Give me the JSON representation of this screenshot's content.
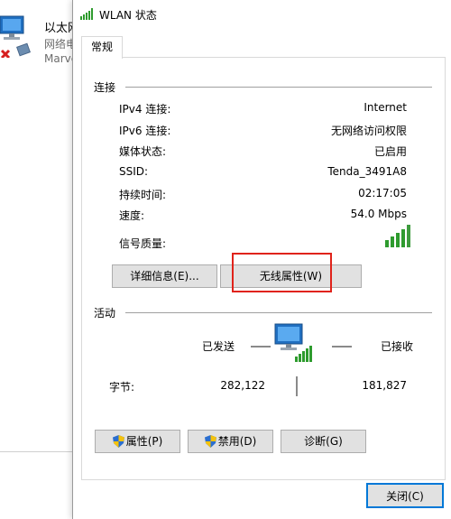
{
  "background_window": {
    "item_name": "以太网",
    "item_status": "网络电缆被拔出",
    "item_adapter": "Marvell"
  },
  "dialog": {
    "title": "WLAN 状态",
    "tab_label": "常规",
    "connection": {
      "section_title": "连接",
      "rows": [
        {
          "label": "IPv4 连接:",
          "value": "Internet"
        },
        {
          "label": "IPv6 连接:",
          "value": "无网络访问权限"
        },
        {
          "label": "媒体状态:",
          "value": "已启用"
        },
        {
          "label": "SSID:",
          "value": "Tenda_3491A8"
        },
        {
          "label": "持续时间:",
          "value": "02:17:05"
        },
        {
          "label": "速度:",
          "value": "54.0 Mbps"
        }
      ],
      "signal_label": "信号质量:",
      "signal_bars_filled": 5,
      "signal_bars_total": 5,
      "details_button": "详细信息(E)...",
      "wireless_props_button": "无线属性(W)"
    },
    "activity": {
      "section_title": "活动",
      "sent_label": "已发送",
      "received_label": "已接收",
      "bytes_label": "字节:",
      "bytes_sent": "282,122",
      "bytes_received": "181,827"
    },
    "buttons": {
      "properties": "属性(P)",
      "disable": "禁用(D)",
      "diagnose": "诊断(G)",
      "close": "关闭(C)"
    }
  },
  "colors": {
    "signal_green": "#2e9b2e",
    "highlight_red": "#e0231b",
    "button_face": "#e1e1e1"
  }
}
